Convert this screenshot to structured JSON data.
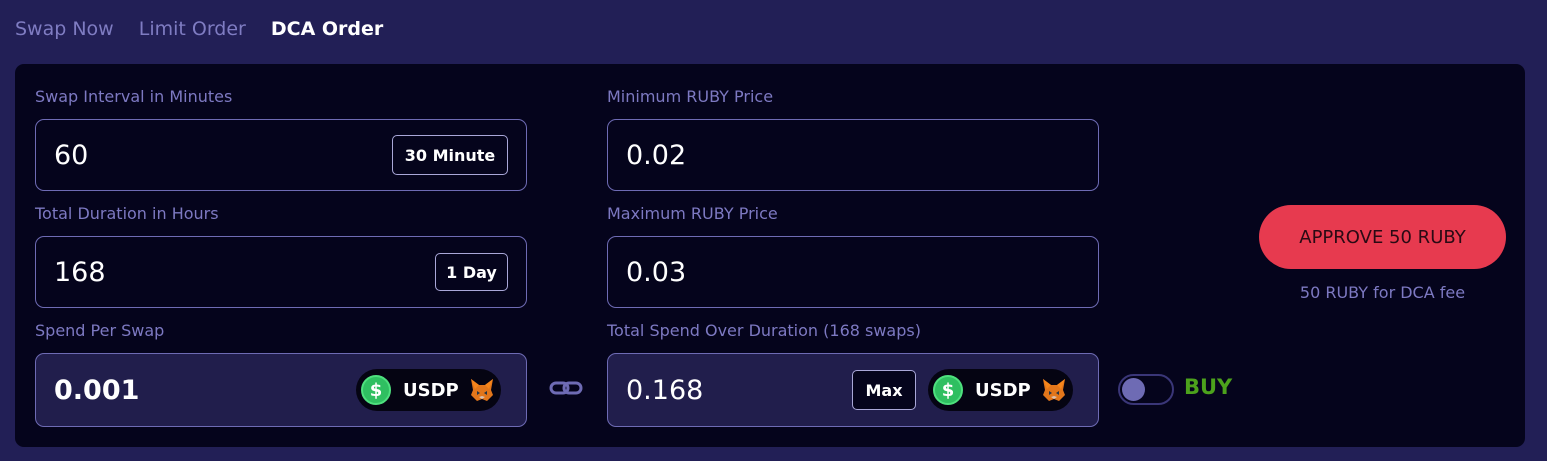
{
  "tabs": [
    {
      "label": "Swap Now",
      "active": false
    },
    {
      "label": "Limit Order",
      "active": false
    },
    {
      "label": "DCA Order",
      "active": true
    }
  ],
  "interval": {
    "label": "Swap Interval in Minutes",
    "value": "60",
    "preset": "30 Minute"
  },
  "duration": {
    "label": "Total Duration in Hours",
    "value": "168",
    "preset": "1 Day"
  },
  "spend_per_swap": {
    "label": "Spend Per Swap",
    "value": "0.001",
    "token": "USDP"
  },
  "min_price": {
    "label": "Minimum RUBY Price",
    "value": "0.02"
  },
  "max_price": {
    "label": "Maximum RUBY Price",
    "value": "0.03"
  },
  "total_spend": {
    "label": "Total Spend Over Duration (168 swaps)",
    "value": "0.168",
    "max_label": "Max",
    "token": "USDP"
  },
  "direction": {
    "label": "BUY",
    "color": "#4ca21c"
  },
  "approve": {
    "label": "APPROVE 50 RUBY",
    "fee_note": "50 RUBY for DCA fee",
    "color": "#e73a4f"
  },
  "icons": {
    "token_icon": "dollar-coin-icon",
    "wallet_icon": "metamask-fox-icon",
    "link_icon": "link-chain-icon"
  },
  "colors": {
    "background": "#221f56",
    "panel": "#05041c",
    "accent": "#7d79c2"
  }
}
